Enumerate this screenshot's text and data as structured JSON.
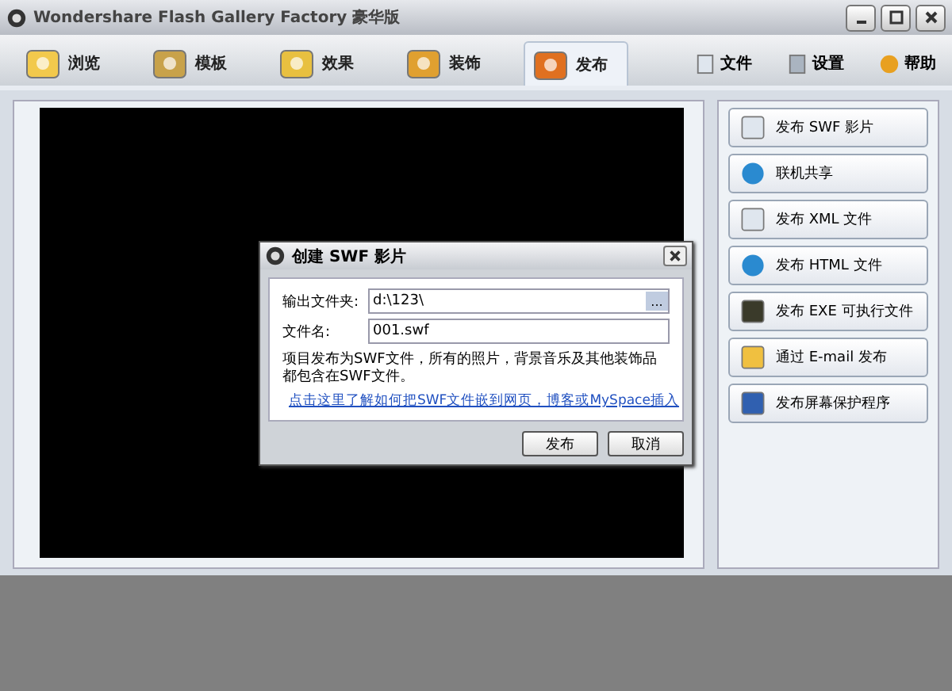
{
  "window": {
    "title": "Wondershare Flash Gallery Factory 豪华版"
  },
  "tabs": [
    {
      "label": "浏览",
      "selected": false
    },
    {
      "label": "模板",
      "selected": false
    },
    {
      "label": "效果",
      "selected": false
    },
    {
      "label": "装饰",
      "selected": false
    },
    {
      "label": "发布",
      "selected": true
    }
  ],
  "menu": [
    {
      "label": "文件"
    },
    {
      "label": "设置"
    },
    {
      "label": "帮助"
    }
  ],
  "publish_buttons": [
    {
      "label": "发布 SWF 影片"
    },
    {
      "label": "联机共享"
    },
    {
      "label": "发布 XML 文件"
    },
    {
      "label": "发布 HTML 文件"
    },
    {
      "label": "发布 EXE 可执行文件"
    },
    {
      "label": "通过 E-mail 发布"
    },
    {
      "label": "发布屏幕保护程序"
    }
  ],
  "dialog": {
    "title": "创建 SWF 影片",
    "fields": [
      {
        "label": "输出文件夹:",
        "value": "d:\\123\\",
        "browse": "..."
      },
      {
        "label": "文件名:",
        "value": "001.swf"
      }
    ],
    "description": "项目发布为SWF文件，所有的照片，背景音乐及其他装饰品都包含在SWF文件。",
    "link": "点击这里了解如何把SWF文件嵌到网页，博客或MySpace插入",
    "buttons": [
      "发布",
      "取消"
    ]
  }
}
